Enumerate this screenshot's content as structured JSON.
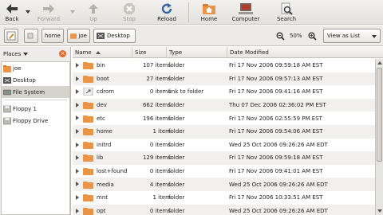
{
  "toolbar": {
    "back": "Back",
    "forward": "Forward",
    "up": "Up",
    "stop": "Stop",
    "reload": "Reload",
    "home": "Home",
    "computer": "Computer",
    "search": "Search"
  },
  "location": {
    "crumbs": [
      "home",
      "joe",
      "Desktop"
    ],
    "zoom": "50%",
    "view_mode": "View as List"
  },
  "sidebar": {
    "header": "Places",
    "items": [
      {
        "label": "joe",
        "icon": "home-folder-icon"
      },
      {
        "label": "Desktop",
        "icon": "desktop-icon"
      },
      {
        "label": "File System",
        "icon": "harddisk-icon"
      },
      {
        "label": "Floppy 1",
        "icon": "floppy-icon"
      },
      {
        "label": "Floppy Drive",
        "icon": "floppy-icon"
      }
    ]
  },
  "list": {
    "columns": [
      "Name",
      "Size",
      "Type",
      "Date Modified"
    ],
    "rows": [
      {
        "name": "bin",
        "size": "107 items",
        "type": "folder",
        "date": "Fri 17 Nov 2006 09:59:18 AM EST"
      },
      {
        "name": "boot",
        "size": "27 items",
        "type": "folder",
        "date": "Fri 17 Nov 2006 09:57:13 AM EST"
      },
      {
        "name": "cdrom",
        "size": "0 items",
        "type": "link to folder",
        "date": "Fri 17 Nov 2006 09:41:16 AM EST"
      },
      {
        "name": "dev",
        "size": "662 items",
        "type": "folder",
        "date": "Thu 07 Dec 2006 02:36:02 PM EST"
      },
      {
        "name": "etc",
        "size": "196 items",
        "type": "folder",
        "date": "Fri 17 Nov 2006 02:55:59 PM EST"
      },
      {
        "name": "home",
        "size": "1 item",
        "type": "folder",
        "date": "Fri 17 Nov 2006 09:54:06 AM EST"
      },
      {
        "name": "initrd",
        "size": "0 items",
        "type": "folder",
        "date": "Wed 25 Oct 2006 09:26:26 AM EDT"
      },
      {
        "name": "lib",
        "size": "129 items",
        "type": "folder",
        "date": "Fri 17 Nov 2006 09:59:18 AM EST"
      },
      {
        "name": "lost+found",
        "size": "0 items",
        "type": "folder",
        "date": "Fri 17 Nov 2006 09:41:01 AM EST"
      },
      {
        "name": "media",
        "size": "4 items",
        "type": "folder",
        "date": "Wed 25 Oct 2006 09:26:26 AM EDT"
      },
      {
        "name": "mnt",
        "size": "1 item",
        "type": "folder",
        "date": "Fri 17 Nov 2006 10:33:51 AM EST"
      },
      {
        "name": "opt",
        "size": "0 items",
        "type": "folder",
        "date": "Wed 25 Oct 2006 09:26:26 AM EDT"
      }
    ]
  },
  "colors": {
    "folder": "#e8954a",
    "accent": "#e46a2c",
    "selection": "#d6d3cd"
  }
}
